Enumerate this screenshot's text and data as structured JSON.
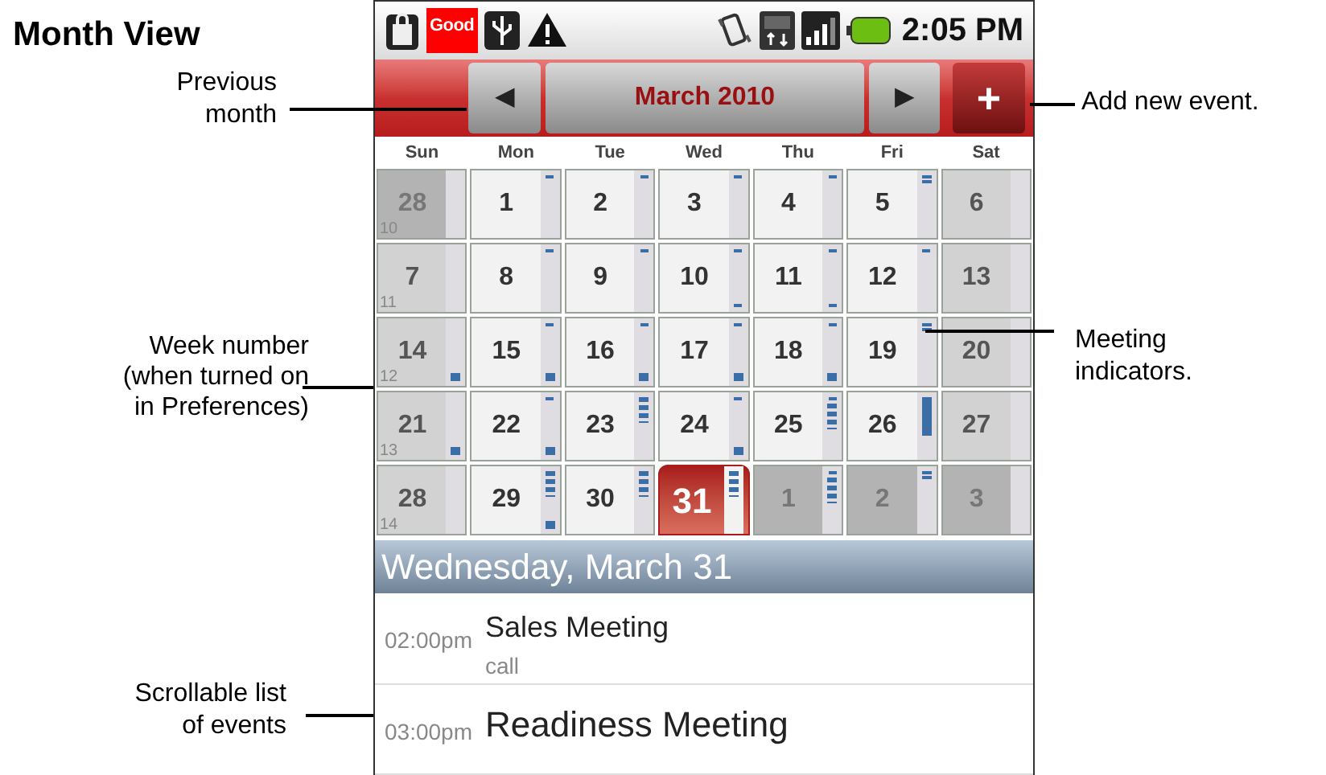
{
  "title": "Month View",
  "callouts": {
    "previous_month": "Previous\nmonth",
    "add_event": "Add new event.",
    "week_number": "Week number\n(when turned on\nin Preferences)",
    "meeting_indicators": "Meeting\nindicators.",
    "event_list": "Scrollable list\nof events"
  },
  "status_bar": {
    "badge": "Good",
    "time": "2:05 PM"
  },
  "header": {
    "prev": "◀",
    "month": "March 2010",
    "next": "▶",
    "add": "+"
  },
  "day_names": [
    "Sun",
    "Mon",
    "Tue",
    "Wed",
    "Thu",
    "Fri",
    "Sat"
  ],
  "weeks": [
    {
      "week_number": "10",
      "days": [
        {
          "number": "28",
          "kind": "other_month",
          "selected": false
        },
        {
          "number": "1",
          "kind": "weekday",
          "selected": false,
          "marks": [
            {
              "kind": "top"
            }
          ]
        },
        {
          "number": "2",
          "kind": "weekday",
          "selected": false,
          "marks": [
            {
              "kind": "top"
            }
          ]
        },
        {
          "number": "3",
          "kind": "weekday",
          "selected": false,
          "marks": [
            {
              "kind": "top"
            }
          ]
        },
        {
          "number": "4",
          "kind": "weekday",
          "selected": false,
          "marks": [
            {
              "kind": "top"
            }
          ]
        },
        {
          "number": "5",
          "kind": "weekday",
          "selected": false,
          "marks": [
            {
              "kind": "double"
            }
          ]
        },
        {
          "number": "6",
          "kind": "weekend",
          "selected": false
        }
      ]
    },
    {
      "week_number": "11",
      "days": [
        {
          "number": "7",
          "kind": "weekend",
          "selected": false
        },
        {
          "number": "8",
          "kind": "weekday",
          "selected": false,
          "marks": [
            {
              "kind": "top"
            }
          ]
        },
        {
          "number": "9",
          "kind": "weekday",
          "selected": false,
          "marks": [
            {
              "kind": "top"
            }
          ]
        },
        {
          "number": "10",
          "kind": "weekday",
          "selected": false,
          "marks": [
            {
              "kind": "top"
            },
            {
              "kind": "bottom"
            }
          ]
        },
        {
          "number": "11",
          "kind": "weekday",
          "selected": false,
          "marks": [
            {
              "kind": "top"
            },
            {
              "kind": "bottom"
            }
          ]
        },
        {
          "number": "12",
          "kind": "weekday",
          "selected": false,
          "marks": [
            {
              "kind": "top"
            }
          ]
        },
        {
          "number": "13",
          "kind": "weekend",
          "selected": false
        }
      ]
    },
    {
      "week_number": "12",
      "days": [
        {
          "number": "14",
          "kind": "weekend",
          "selected": false,
          "marks": [
            {
              "kind": "block"
            }
          ]
        },
        {
          "number": "15",
          "kind": "weekday",
          "selected": false,
          "marks": [
            {
              "kind": "top"
            },
            {
              "kind": "block"
            }
          ]
        },
        {
          "number": "16",
          "kind": "weekday",
          "selected": false,
          "marks": [
            {
              "kind": "top"
            },
            {
              "kind": "block"
            }
          ]
        },
        {
          "number": "17",
          "kind": "weekday",
          "selected": false,
          "marks": [
            {
              "kind": "top"
            },
            {
              "kind": "block"
            }
          ]
        },
        {
          "number": "18",
          "kind": "weekday",
          "selected": false,
          "marks": [
            {
              "kind": "top"
            },
            {
              "kind": "block"
            }
          ]
        },
        {
          "number": "19",
          "kind": "weekday",
          "selected": false,
          "marks": [
            {
              "kind": "double"
            }
          ]
        },
        {
          "number": "20",
          "kind": "weekend",
          "selected": false
        }
      ]
    },
    {
      "week_number": "13",
      "days": [
        {
          "number": "21",
          "kind": "weekend",
          "selected": false,
          "marks": [
            {
              "kind": "block"
            }
          ]
        },
        {
          "number": "22",
          "kind": "weekday",
          "selected": false,
          "marks": [
            {
              "kind": "top"
            },
            {
              "kind": "block"
            }
          ]
        },
        {
          "number": "23",
          "kind": "weekday",
          "selected": false,
          "marks": [
            {
              "kind": "stack"
            }
          ]
        },
        {
          "number": "24",
          "kind": "weekday",
          "selected": false,
          "marks": [
            {
              "kind": "top"
            },
            {
              "kind": "block"
            }
          ]
        },
        {
          "number": "25",
          "kind": "weekday",
          "selected": false,
          "marks": [
            {
              "kind": "top"
            },
            {
              "kind": "stack"
            }
          ]
        },
        {
          "number": "26",
          "kind": "weekday",
          "selected": false,
          "marks": [
            {
              "kind": "tall"
            }
          ]
        },
        {
          "number": "27",
          "kind": "weekend",
          "selected": false
        }
      ]
    },
    {
      "week_number": "14",
      "days": [
        {
          "number": "28",
          "kind": "weekend",
          "selected": false
        },
        {
          "number": "29",
          "kind": "weekday",
          "selected": false,
          "marks": [
            {
              "kind": "stack"
            },
            {
              "kind": "block"
            }
          ]
        },
        {
          "number": "30",
          "kind": "weekday",
          "selected": false,
          "marks": [
            {
              "kind": "stack"
            }
          ]
        },
        {
          "number": "31",
          "kind": "weekday",
          "selected": true,
          "marks": [
            {
              "kind": "stack"
            }
          ]
        },
        {
          "number": "1",
          "kind": "other_month",
          "selected": false,
          "marks": [
            {
              "kind": "top"
            },
            {
              "kind": "stack"
            }
          ]
        },
        {
          "number": "2",
          "kind": "other_month",
          "selected": false,
          "marks": [
            {
              "kind": "double"
            }
          ]
        },
        {
          "number": "3",
          "kind": "other_month",
          "selected": false
        }
      ]
    }
  ],
  "day_header": "Wednesday, March 31",
  "events": [
    {
      "time": "02:00pm",
      "title": "Sales Meeting",
      "subtitle": "call"
    },
    {
      "time": "03:00pm",
      "title": "Readiness Meeting"
    }
  ]
}
